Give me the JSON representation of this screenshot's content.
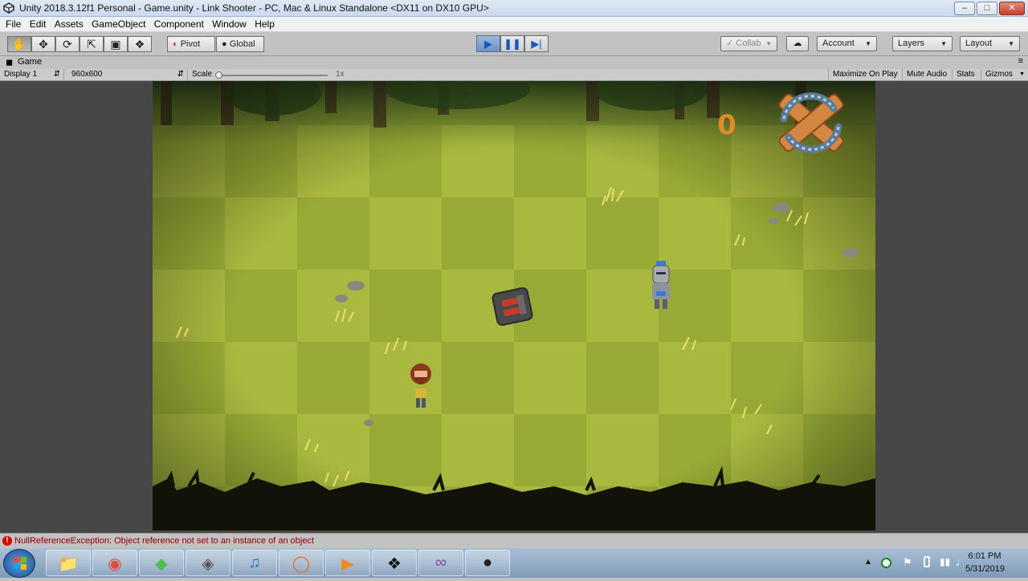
{
  "window": {
    "title": "Unity 2018.3.12f1 Personal - Game.unity - Link Shooter - PC, Mac & Linux Standalone <DX11 on DX10 GPU>"
  },
  "menu": [
    "File",
    "Edit",
    "Assets",
    "GameObject",
    "Component",
    "Window",
    "Help"
  ],
  "toolbar": {
    "pivot": "Pivot",
    "global": "Global",
    "collab": "Collab",
    "account": "Account",
    "layers": "Layers",
    "layout": "Layout"
  },
  "game_tab": {
    "title": "Game",
    "display": "Display 1",
    "resolution": "960x600",
    "scale_label": "Scale",
    "scale_value": "1x",
    "scale_level": 0.0,
    "maximize": "Maximize On Play",
    "mute": "Mute Audio",
    "stats": "Stats",
    "gizmos": "Gizmos"
  },
  "hud": {
    "score": "0"
  },
  "console": {
    "message": "NullReferenceException: Object reference not set to an instance of an object"
  },
  "taskbar": {
    "time": "6:01 PM",
    "date": "5/31/2019",
    "apps": [
      "explorer-icon",
      "chrome-icon",
      "sims-icon",
      "gimp-icon",
      "audition-icon",
      "origin-icon",
      "media-player-icon",
      "unity-icon",
      "visual-studio-icon",
      "obs-icon"
    ]
  },
  "colors": {
    "accent": "#3a7bd5",
    "error": "#d40000",
    "grass": "#9aae3a",
    "score": "#e08a2a"
  }
}
